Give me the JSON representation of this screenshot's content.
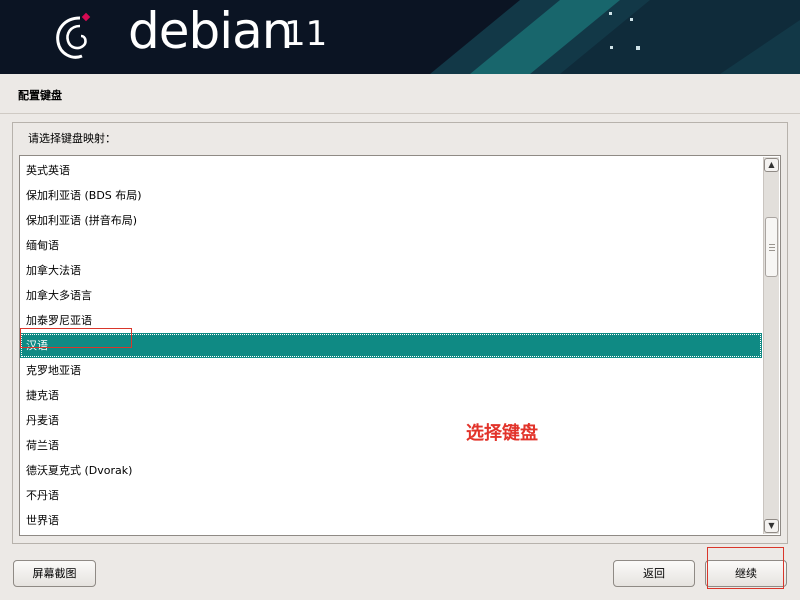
{
  "header": {
    "brand": "debian",
    "version": "11",
    "colors": {
      "background": "#0b1423",
      "accent": "#1a6f73",
      "logo_red": "#d70a53"
    }
  },
  "page": {
    "title": "配置键盘",
    "prompt": "请选择键盘映射："
  },
  "keymap_list": {
    "items": [
      "英式英语",
      "保加利亚语 (BDS 布局)",
      "保加利亚语 (拼音布局)",
      "缅甸语",
      "加拿大法语",
      "加拿大多语言",
      "加泰罗尼亚语",
      "汉语",
      "克罗地亚语",
      "捷克语",
      "丹麦语",
      "荷兰语",
      "德沃夏克式 (Dvorak)",
      "不丹语",
      "世界语"
    ],
    "selected": "汉语",
    "selection_color": "#0f8a84"
  },
  "scrollbar": {
    "up_icon": "arrow-up-icon",
    "down_icon": "arrow-down-icon"
  },
  "annotation": {
    "label": "选择键盘",
    "color": "#e2332a"
  },
  "buttons": {
    "screenshot": "屏幕截图",
    "back": "返回",
    "continue": "继续"
  }
}
